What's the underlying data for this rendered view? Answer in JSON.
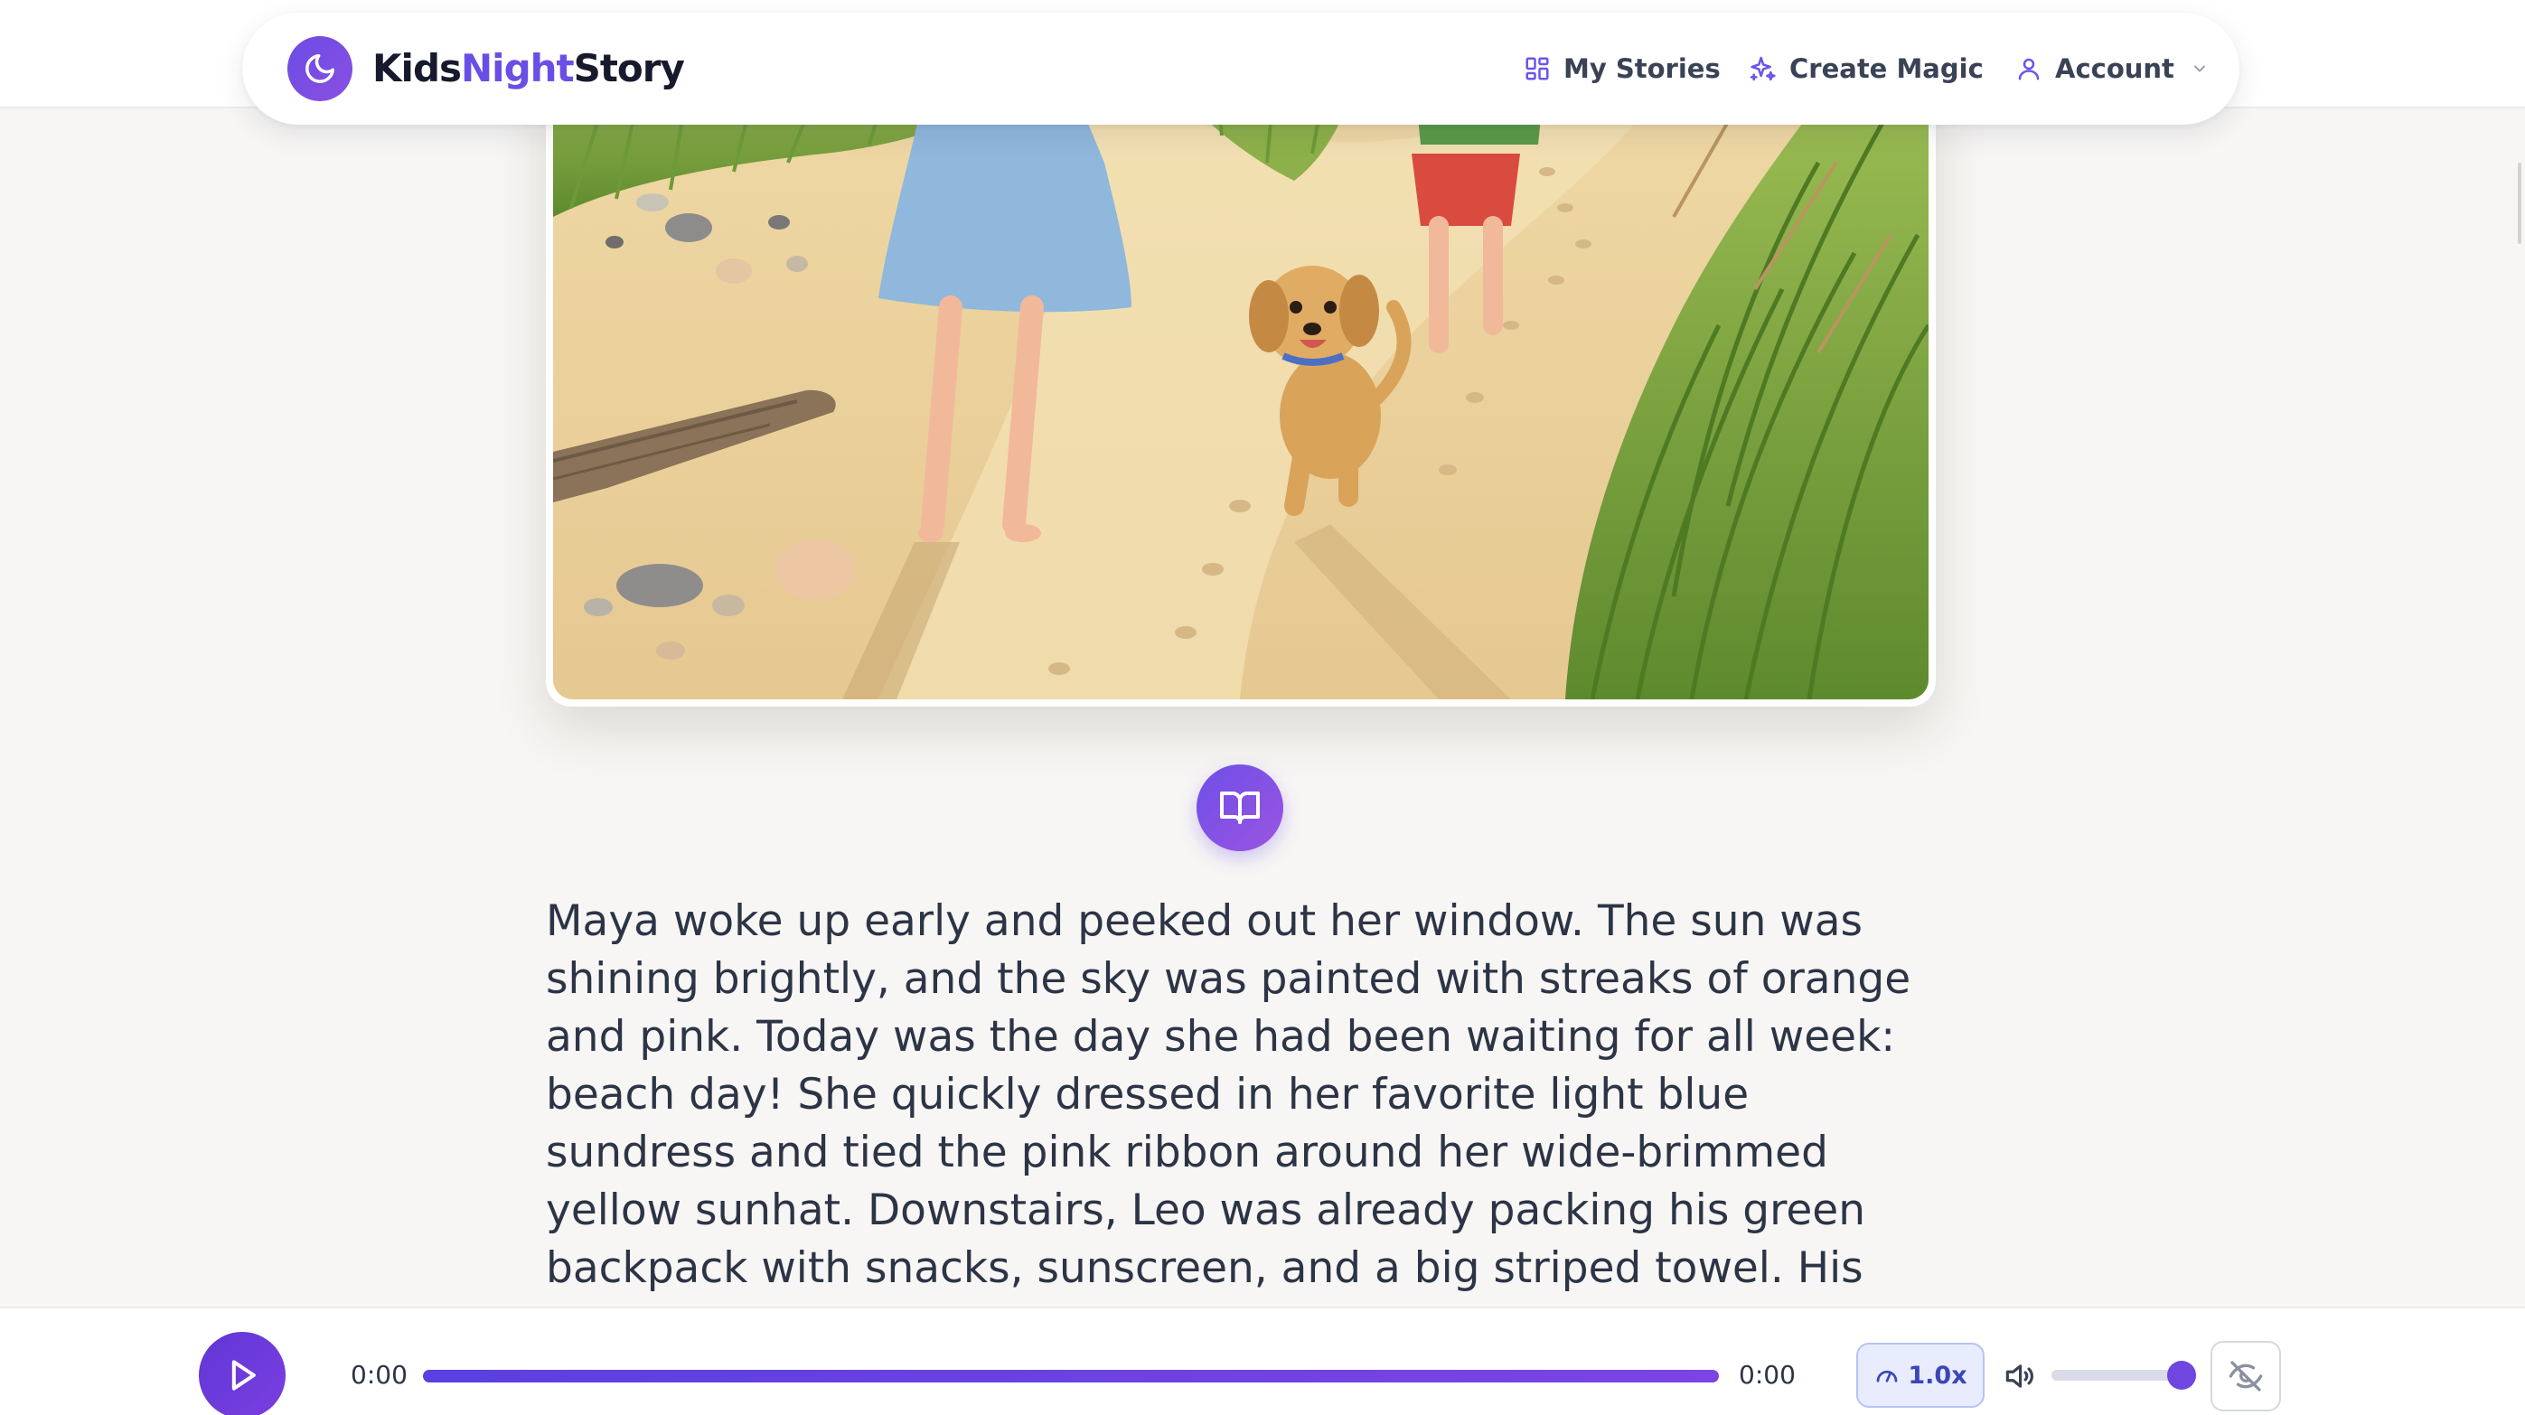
{
  "app": {
    "brand_part1": "Kids",
    "brand_part2": "Night",
    "brand_part3": "Story",
    "logo_icon": "moon-icon"
  },
  "nav": {
    "my_stories": "My Stories",
    "create_magic": "Create Magic",
    "account": "Account"
  },
  "colors": {
    "accent": "#6a4ee6",
    "accent_dark": "#6236d6",
    "text": "#2c3446",
    "background": "#f7f6f4"
  },
  "illustration": {
    "icon": "story-illustration"
  },
  "read_button": {
    "icon": "book-open-icon"
  },
  "story": {
    "text": "Maya woke up early and peeked out her window. The sun was shining brightly, and the sky was painted with streaks of orange and pink. Today was the day she had been waiting for all week: beach day! She quickly dressed in her favorite light blue sundress and tied the pink ribbon around her wide-brimmed yellow sunhat. Downstairs, Leo was already packing his green backpack with snacks, sunscreen, and a big striped towel. His bright red swim"
  },
  "player": {
    "current_time": "0:00",
    "duration": "0:00",
    "progress": 1.0,
    "speed": "1.0x",
    "volume": 1.0,
    "play_icon": "play-icon",
    "speed_icon": "gauge-icon",
    "volume_icon": "volume-icon",
    "hide_icon": "eye-off-icon"
  }
}
